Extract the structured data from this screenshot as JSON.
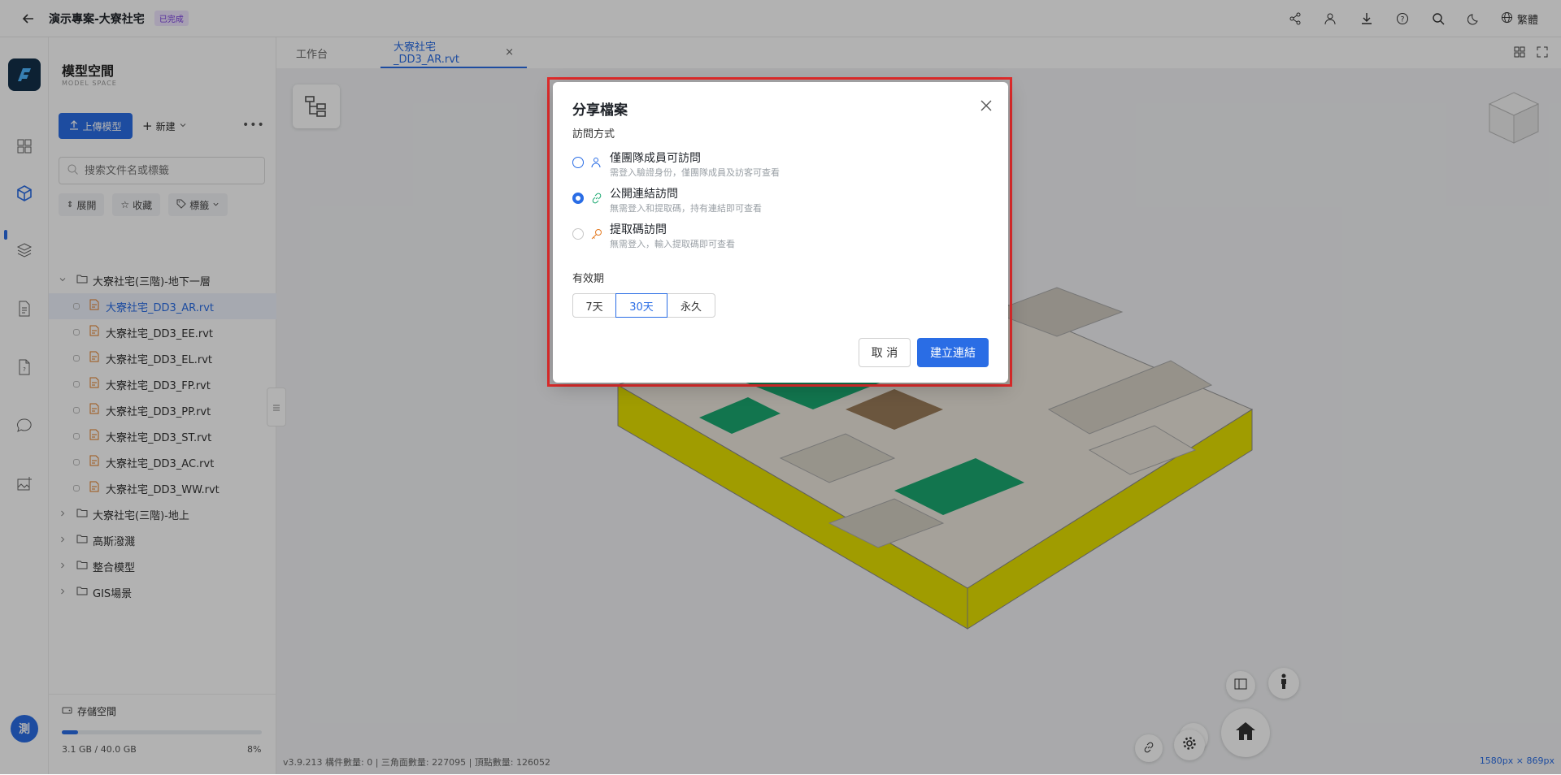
{
  "header": {
    "title": "演示專案-大寮社宅",
    "status_badge": "已完成",
    "language": "繁體",
    "icons": [
      "share-icon",
      "team-icon",
      "download-icon",
      "help-icon",
      "search-icon",
      "moon-icon",
      "globe-icon"
    ]
  },
  "rail": {
    "items": [
      "grid-icon",
      "cube-icon",
      "layers-icon",
      "document-icon",
      "file-icon",
      "chat-icon",
      "image-icon"
    ],
    "avatar_text": "測"
  },
  "panel": {
    "title": "模型空間",
    "subtitle": "MODEL SPACE",
    "upload_label": "上傳模型",
    "new_label": "新建",
    "search_placeholder": "搜索文件名或標籤",
    "filters": {
      "expand": "展開",
      "favorites": "收藏",
      "tags": "標籤"
    },
    "tree": [
      {
        "label": "大寮社宅(三階)-地下一層",
        "type": "folder",
        "expanded": true
      },
      {
        "label": "大寮社宅_DD3_AR.rvt",
        "type": "file",
        "active": true
      },
      {
        "label": "大寮社宅_DD3_EE.rvt",
        "type": "file"
      },
      {
        "label": "大寮社宅_DD3_EL.rvt",
        "type": "file"
      },
      {
        "label": "大寮社宅_DD3_FP.rvt",
        "type": "file"
      },
      {
        "label": "大寮社宅_DD3_PP.rvt",
        "type": "file"
      },
      {
        "label": "大寮社宅_DD3_ST.rvt",
        "type": "file"
      },
      {
        "label": "大寮社宅_DD3_AC.rvt",
        "type": "file"
      },
      {
        "label": "大寮社宅_DD3_WW.rvt",
        "type": "file"
      },
      {
        "label": "大寮社宅(三階)-地上",
        "type": "folder"
      },
      {
        "label": "高斯潑濺",
        "type": "folder"
      },
      {
        "label": "整合模型",
        "type": "folder"
      },
      {
        "label": "GIS場景",
        "type": "folder"
      }
    ],
    "storage": {
      "title": "存儲空間",
      "used": "3.1 GB / 40.0 GB",
      "percent_label": "8%",
      "percent": 0.08
    }
  },
  "tabs": [
    {
      "label": "工作台"
    },
    {
      "label": "大寮社宅_DD3_AR.rvt",
      "active": true
    }
  ],
  "viewport": {
    "status": "v3.9.213   構件數量: 0 | 三角面數量: 227095 | 頂點數量: 126052",
    "resolution": "1580px × 869px"
  },
  "dialog": {
    "title": "分享檔案",
    "access_label": "訪問方式",
    "options": [
      {
        "label": "僅團隊成員可訪問",
        "desc": "需登入驗證身份，僅團隊成員及訪客可查看",
        "checked": false,
        "icon": "team-icon"
      },
      {
        "label": "公開連結訪問",
        "desc": "無需登入和提取碼，持有連結即可查看",
        "checked": true,
        "icon": "link-icon"
      },
      {
        "label": "提取碼訪問",
        "desc": "無需登入，輸入提取碼即可查看",
        "checked": false,
        "icon": "key-icon"
      }
    ],
    "validity_label": "有效期",
    "validity_options": [
      "7天",
      "30天",
      "永久"
    ],
    "validity_selected": "30天",
    "cancel_label": "取 消",
    "create_label": "建立連結"
  },
  "colors": {
    "accent": "#2a6de5",
    "badge_bg": "#efe5ff",
    "badge_fg": "#7a3ee0",
    "highlight": "#e02b2b"
  }
}
